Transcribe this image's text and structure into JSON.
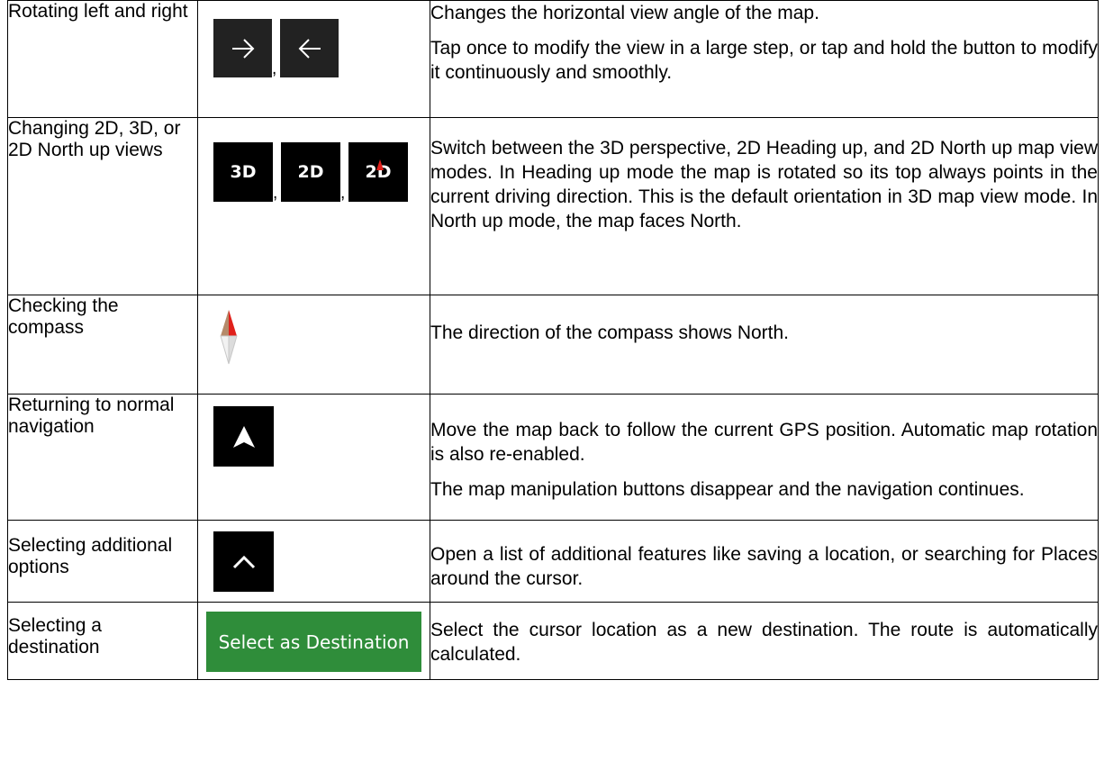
{
  "rows": [
    {
      "action": "Rotating left and right",
      "buttons": [
        "arrow-right-icon",
        "arrow-left-icon"
      ],
      "separator": ",",
      "description": [
        "Changes the horizontal view angle of the map.",
        "Tap once to modify the view in a large step, or tap and hold the button to modify it continuously and smoothly."
      ]
    },
    {
      "action": "Changing 2D, 3D, or 2D North up views",
      "buttons": [
        "3D",
        "2D",
        "2D"
      ],
      "separator": ",",
      "description": [
        "Switch between the 3D perspective, 2D Heading up, and 2D North up map view modes. In Heading up mode the map is rotated so its top always points in the current driving direction. This is the default orientation in 3D map view mode. In North up mode, the map faces North."
      ]
    },
    {
      "action": "Checking the compass",
      "buttons": [
        "compass-icon"
      ],
      "description": [
        "The direction of the compass shows North."
      ]
    },
    {
      "action": "Returning to normal navigation",
      "buttons": [
        "navigation-arrow-icon"
      ],
      "description": [
        "Move the map back to follow the current GPS position. Automatic map rotation is also re-enabled.",
        "The map manipulation buttons disappear and the navigation continues."
      ]
    },
    {
      "action": "Selecting additional options",
      "buttons": [
        "chevron-up-icon"
      ],
      "description": [
        "Open a list of additional features like saving a location, or searching for Places around the cursor."
      ]
    },
    {
      "action": "Selecting a destination",
      "buttons": [
        "Select as Destination"
      ],
      "description": [
        "Select the cursor location as a new destination. The route is automatically calculated."
      ]
    }
  ],
  "colors": {
    "button_dark": "#222222",
    "button_black": "#000000",
    "button_green": "#2f8d3a",
    "compass_red": "#e0201b"
  }
}
